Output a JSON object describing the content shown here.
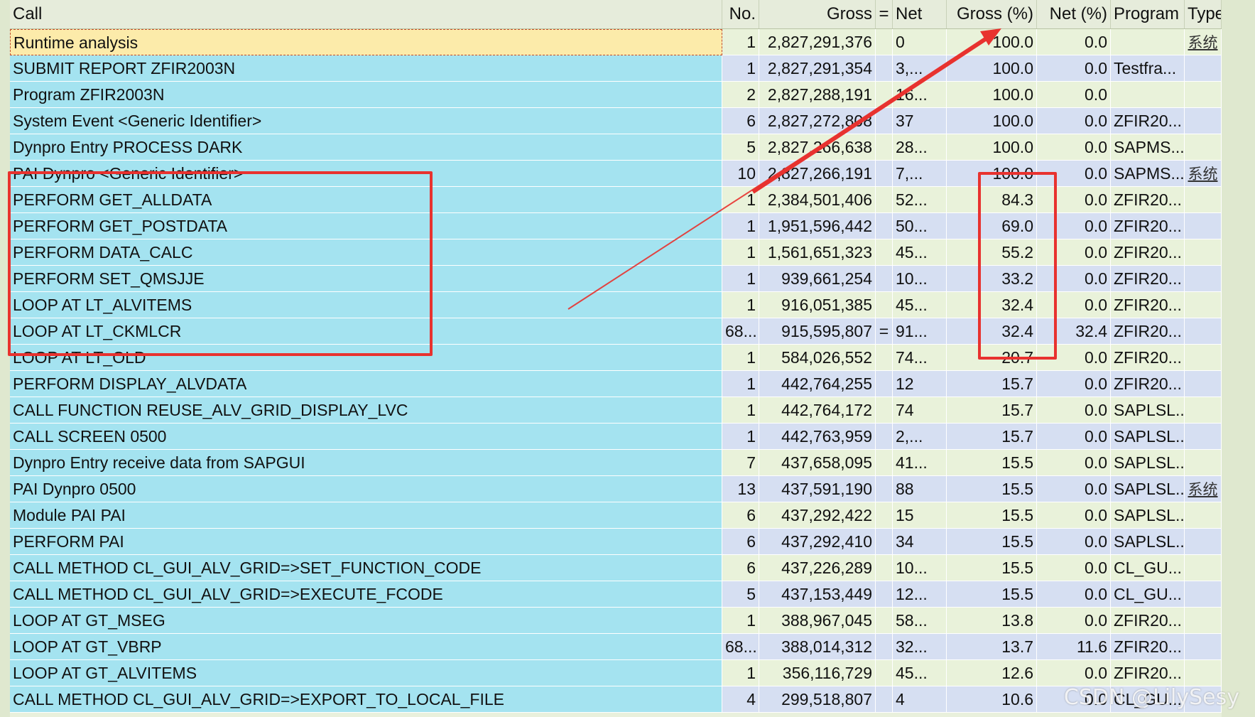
{
  "columns": {
    "call": "Call",
    "no": "No.",
    "gross": "Gross",
    "eq": "=",
    "net": "Net",
    "gross_pct": "Gross (%)",
    "net_pct": "Net (%)",
    "program": "Program",
    "type": "Type"
  },
  "rows": [
    {
      "call": "Runtime analysis",
      "no": "1",
      "gross": "2,827,291,376",
      "eq": "",
      "net": "0",
      "gross_pct": "100.0",
      "net_pct": "0.0",
      "program": "",
      "type": "系统"
    },
    {
      "call": "SUBMIT REPORT ZFIR2003N",
      "no": "1",
      "gross": "2,827,291,354",
      "eq": "",
      "net": "3,...",
      "gross_pct": "100.0",
      "net_pct": "0.0",
      "program": "Testfra...",
      "type": ""
    },
    {
      "call": "Program ZFIR2003N",
      "no": "2",
      "gross": "2,827,288,191",
      "eq": "",
      "net": "16...",
      "gross_pct": "100.0",
      "net_pct": "0.0",
      "program": "",
      "type": ""
    },
    {
      "call": "System Event <Generic Identifier>",
      "no": "6",
      "gross": "2,827,272,808",
      "eq": "",
      "net": "37",
      "gross_pct": "100.0",
      "net_pct": "0.0",
      "program": "ZFIR20...",
      "type": ""
    },
    {
      "call": "Dynpro Entry PROCESS DARK",
      "no": "5",
      "gross": "2,827,266,638",
      "eq": "",
      "net": "28...",
      "gross_pct": "100.0",
      "net_pct": "0.0",
      "program": "SAPMS...",
      "type": ""
    },
    {
      "call": "PAI Dynpro <Generic Identifier>",
      "no": "10",
      "gross": "2,827,266,191",
      "eq": "",
      "net": "7,...",
      "gross_pct": "100.0",
      "net_pct": "0.0",
      "program": "SAPMS...",
      "type": "系统"
    },
    {
      "call": "PERFORM GET_ALLDATA",
      "no": "1",
      "gross": "2,384,501,406",
      "eq": "",
      "net": "52...",
      "gross_pct": "84.3",
      "net_pct": "0.0",
      "program": "ZFIR20...",
      "type": ""
    },
    {
      "call": "PERFORM GET_POSTDATA",
      "no": "1",
      "gross": "1,951,596,442",
      "eq": "",
      "net": "50...",
      "gross_pct": "69.0",
      "net_pct": "0.0",
      "program": "ZFIR20...",
      "type": ""
    },
    {
      "call": "PERFORM DATA_CALC",
      "no": "1",
      "gross": "1,561,651,323",
      "eq": "",
      "net": "45...",
      "gross_pct": "55.2",
      "net_pct": "0.0",
      "program": "ZFIR20...",
      "type": ""
    },
    {
      "call": "PERFORM SET_QMSJJE",
      "no": "1",
      "gross": "939,661,254",
      "eq": "",
      "net": "10...",
      "gross_pct": "33.2",
      "net_pct": "0.0",
      "program": "ZFIR20...",
      "type": ""
    },
    {
      "call": "LOOP AT LT_ALVITEMS",
      "no": "1",
      "gross": "916,051,385",
      "eq": "",
      "net": "45...",
      "gross_pct": "32.4",
      "net_pct": "0.0",
      "program": "ZFIR20...",
      "type": ""
    },
    {
      "call": "LOOP AT LT_CKMLCR",
      "no": "68...",
      "gross": "915,595,807",
      "eq": "=",
      "net": "91...",
      "gross_pct": "32.4",
      "net_pct": "32.4",
      "program": "ZFIR20...",
      "type": ""
    },
    {
      "call": "LOOP AT LT_OLD",
      "no": "1",
      "gross": "584,026,552",
      "eq": "",
      "net": "74...",
      "gross_pct": "20.7",
      "net_pct": "0.0",
      "program": "ZFIR20...",
      "type": ""
    },
    {
      "call": "PERFORM DISPLAY_ALVDATA",
      "no": "1",
      "gross": "442,764,255",
      "eq": "",
      "net": "12",
      "gross_pct": "15.7",
      "net_pct": "0.0",
      "program": "ZFIR20...",
      "type": ""
    },
    {
      "call": "CALL FUNCTION REUSE_ALV_GRID_DISPLAY_LVC",
      "no": "1",
      "gross": "442,764,172",
      "eq": "",
      "net": "74",
      "gross_pct": "15.7",
      "net_pct": "0.0",
      "program": "SAPLSL...",
      "type": ""
    },
    {
      "call": "CALL SCREEN 0500",
      "no": "1",
      "gross": "442,763,959",
      "eq": "",
      "net": "2,...",
      "gross_pct": "15.7",
      "net_pct": "0.0",
      "program": "SAPLSL...",
      "type": ""
    },
    {
      "call": "Dynpro Entry receive data from SAPGUI",
      "no": "7",
      "gross": "437,658,095",
      "eq": "",
      "net": "41...",
      "gross_pct": "15.5",
      "net_pct": "0.0",
      "program": "SAPLSL...",
      "type": ""
    },
    {
      "call": "PAI Dynpro 0500",
      "no": "13",
      "gross": "437,591,190",
      "eq": "",
      "net": "88",
      "gross_pct": "15.5",
      "net_pct": "0.0",
      "program": "SAPLSL...",
      "type": "系统"
    },
    {
      "call": "Module PAI PAI",
      "no": "6",
      "gross": "437,292,422",
      "eq": "",
      "net": "15",
      "gross_pct": "15.5",
      "net_pct": "0.0",
      "program": "SAPLSL...",
      "type": ""
    },
    {
      "call": "PERFORM PAI",
      "no": "6",
      "gross": "437,292,410",
      "eq": "",
      "net": "34",
      "gross_pct": "15.5",
      "net_pct": "0.0",
      "program": "SAPLSL...",
      "type": ""
    },
    {
      "call": "CALL METHOD CL_GUI_ALV_GRID=>SET_FUNCTION_CODE",
      "no": "6",
      "gross": "437,226,289",
      "eq": "",
      "net": "10...",
      "gross_pct": "15.5",
      "net_pct": "0.0",
      "program": "CL_GU...",
      "type": ""
    },
    {
      "call": "CALL METHOD CL_GUI_ALV_GRID=>EXECUTE_FCODE",
      "no": "5",
      "gross": "437,153,449",
      "eq": "",
      "net": "12...",
      "gross_pct": "15.5",
      "net_pct": "0.0",
      "program": "CL_GU...",
      "type": ""
    },
    {
      "call": "LOOP AT GT_MSEG",
      "no": "1",
      "gross": "388,967,045",
      "eq": "",
      "net": "58...",
      "gross_pct": "13.8",
      "net_pct": "0.0",
      "program": "ZFIR20...",
      "type": ""
    },
    {
      "call": "LOOP AT GT_VBRP",
      "no": "68...",
      "gross": "388,014,312",
      "eq": "",
      "net": "32...",
      "gross_pct": "13.7",
      "net_pct": "11.6",
      "program": "ZFIR20...",
      "type": ""
    },
    {
      "call": "LOOP AT GT_ALVITEMS",
      "no": "1",
      "gross": "356,116,729",
      "eq": "",
      "net": "45...",
      "gross_pct": "12.6",
      "net_pct": "0.0",
      "program": "ZFIR20...",
      "type": ""
    },
    {
      "call": "CALL METHOD CL_GUI_ALV_GRID=>EXPORT_TO_LOCAL_FILE",
      "no": "4",
      "gross": "299,518,807",
      "eq": "",
      "net": "4",
      "gross_pct": "10.6",
      "net_pct": "0.0",
      "program": "CL_GU...",
      "type": ""
    }
  ],
  "selected_row": 0,
  "highlight_color": "#e8322f",
  "watermark": "CSDN @LilySesy"
}
